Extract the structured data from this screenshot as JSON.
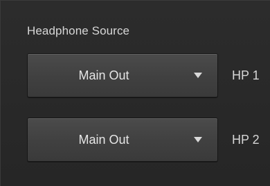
{
  "section": {
    "title": "Headphone Source"
  },
  "outputs": [
    {
      "selected": "Main Out",
      "label": "HP 1",
      "icon": "chevron-down-icon"
    },
    {
      "selected": "Main Out",
      "label": "HP 2",
      "icon": "chevron-down-icon"
    }
  ],
  "colors": {
    "background": "#262626",
    "dropdown": "#424242",
    "text": "#d7d7d7"
  }
}
